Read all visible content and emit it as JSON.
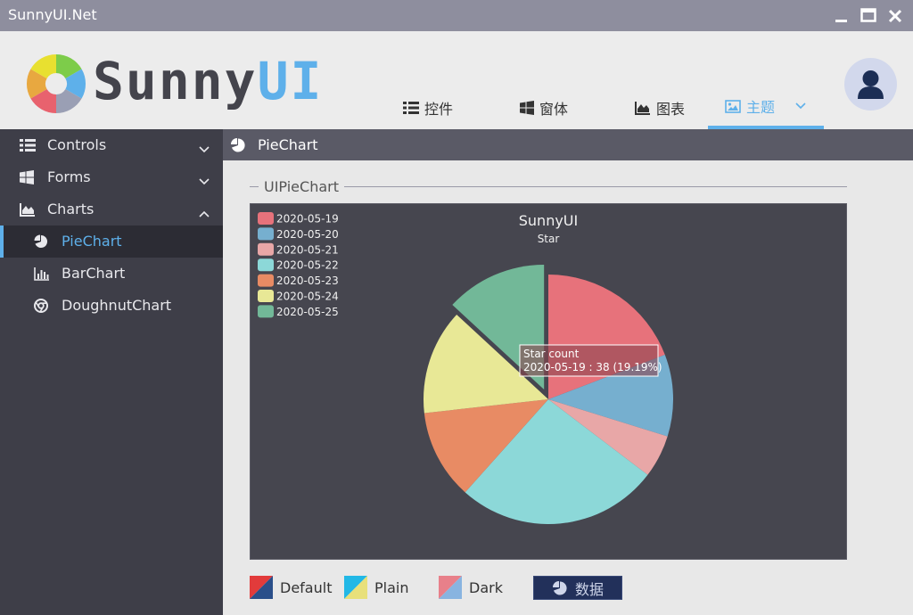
{
  "window": {
    "title": "SunnyUI.Net"
  },
  "header": {
    "logo_text_a": "Sunny",
    "logo_text_b": "UI",
    "nav": [
      {
        "label": "控件",
        "icon": "list-icon"
      },
      {
        "label": "窗体",
        "icon": "windows-icon"
      },
      {
        "label": "图表",
        "icon": "area-chart-icon"
      },
      {
        "label": "主题",
        "icon": "image-icon",
        "active": true
      }
    ]
  },
  "sidebar": {
    "items": [
      {
        "label": "Controls",
        "icon": "list-icon",
        "expanded": false
      },
      {
        "label": "Forms",
        "icon": "windows-icon",
        "expanded": false
      },
      {
        "label": "Charts",
        "icon": "area-chart-icon",
        "expanded": true
      },
      {
        "label": "PieChart",
        "icon": "pie-chart-icon",
        "selected": true
      },
      {
        "label": "BarChart",
        "icon": "bar-chart-icon"
      },
      {
        "label": "DoughnutChart",
        "icon": "chrome-icon"
      }
    ]
  },
  "content": {
    "header_title": "PieChart",
    "group_title": "UIPieChart"
  },
  "chart_data": {
    "type": "pie",
    "title": "SunnyUI",
    "subtitle": "Star",
    "series_name": "Star count",
    "legend_position": "top-left",
    "categories": [
      "2020-05-19",
      "2020-05-20",
      "2020-05-21",
      "2020-05-22",
      "2020-05-23",
      "2020-05-24",
      "2020-05-25"
    ],
    "values": [
      38,
      21,
      11,
      52,
      23,
      27,
      26
    ],
    "colors": [
      "#e7727b",
      "#76afcf",
      "#e8a7a7",
      "#8cd8d8",
      "#e88b64",
      "#e8e896",
      "#72b898"
    ],
    "highlighted_index": 6,
    "tooltip": {
      "title": "Star count",
      "text": "2020-05-19 : 38 (19.19%)"
    }
  },
  "footer": {
    "themes": [
      {
        "label": "Default",
        "colors": [
          "#e23b3b",
          "#2a4f8a"
        ]
      },
      {
        "label": "Plain",
        "colors": [
          "#22b8e6",
          "#e8e07a"
        ]
      },
      {
        "label": "Dark",
        "colors": [
          "#e8808a",
          "#88b4e0"
        ]
      }
    ],
    "data_button": "数据"
  }
}
